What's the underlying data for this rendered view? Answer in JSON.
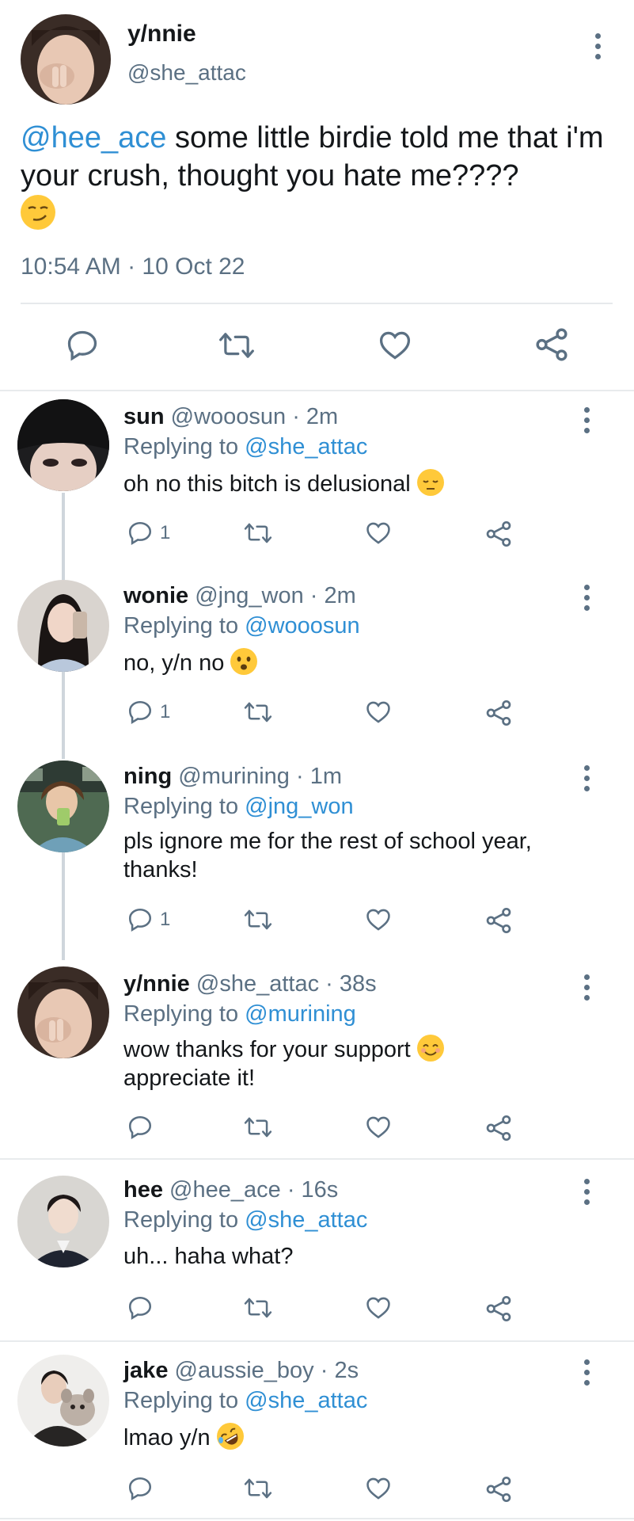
{
  "main_tweet": {
    "name": "y/nnie",
    "handle": "@she_attac",
    "mention": "@hee_ace",
    "text": " some little birdie told me that i'm your crush, thought you hate me????",
    "emoji": "smirk-emoji",
    "timestamp": "10:54 AM · 10 Oct 22"
  },
  "replies": [
    {
      "name": "sun",
      "handle": "@wooosun",
      "time": "· 2m",
      "replying_prefix": "Replying to ",
      "replying_to": "@she_attac",
      "text": "oh no this bitch is delusional",
      "emoji": "pensive-emoji",
      "reply_count": "1"
    },
    {
      "name": "wonie",
      "handle": "@jng_won",
      "time": "· 2m",
      "replying_prefix": "Replying to ",
      "replying_to": "@wooosun",
      "text": "no, y/n no",
      "emoji": "worried-emoji",
      "reply_count": "1"
    },
    {
      "name": "ning",
      "handle": "@murining",
      "time": "· 1m",
      "replying_prefix": "Replying to ",
      "replying_to": "@jng_won",
      "text": "pls ignore me for the rest of school year, thanks!",
      "emoji": "",
      "reply_count": "1"
    },
    {
      "name": "y/nnie",
      "handle": "@she_attac",
      "time": "· 38s",
      "replying_prefix": "Replying to ",
      "replying_to": "@murining",
      "text": "wow thanks for your support",
      "text2": "appreciate it!",
      "emoji": "smiling-blush-emoji",
      "reply_count": ""
    },
    {
      "name": "hee",
      "handle": "@hee_ace",
      "time": "· 16s",
      "replying_prefix": "Replying to ",
      "replying_to": "@she_attac",
      "text": "uh... haha what?",
      "emoji": "",
      "reply_count": ""
    },
    {
      "name": "jake",
      "handle": "@aussie_boy",
      "time": "· 2s",
      "replying_prefix": "Replying to ",
      "replying_to": "@she_attac",
      "text": "lmao y/n",
      "emoji": "rofl-emoji",
      "reply_count": ""
    }
  ],
  "icons": {
    "reply": "reply-icon",
    "retweet": "retweet-icon",
    "like": "heart-icon",
    "share": "share-icon",
    "more": "more-icon"
  },
  "colors": {
    "text": "#14171a",
    "secondary": "#5b7083",
    "mention": "#2f8fd4",
    "divider": "#e8ebed"
  }
}
